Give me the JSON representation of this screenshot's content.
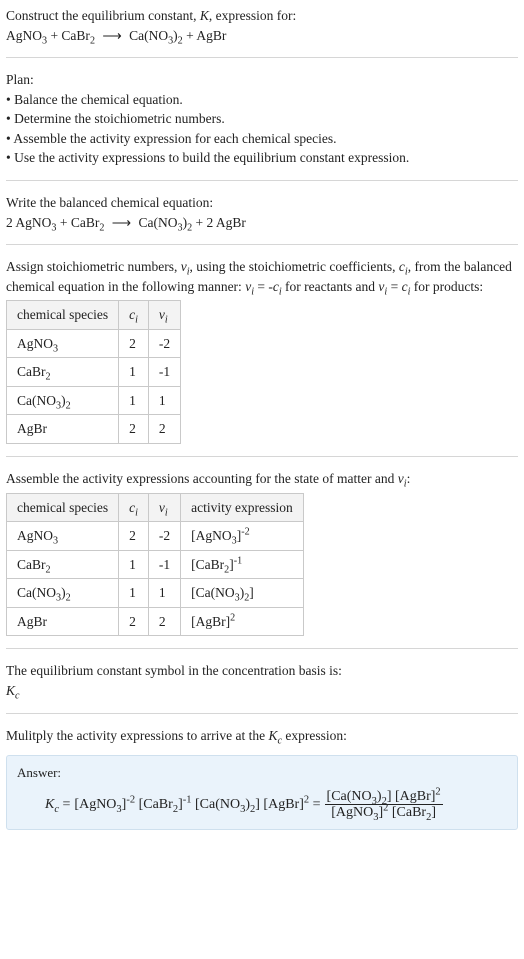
{
  "header": {
    "prompt_line1": "Construct the equilibrium constant, K, expression for:",
    "reaction_unbalanced": "AgNO₃ + CaBr₂  ⟶  Ca(NO₃)₂ + AgBr"
  },
  "plan": {
    "title": "Plan:",
    "items": [
      "Balance the chemical equation.",
      "Determine the stoichiometric numbers.",
      "Assemble the activity expression for each chemical species.",
      "Use the activity expressions to build the equilibrium constant expression."
    ]
  },
  "balanced": {
    "intro": "Write the balanced chemical equation:",
    "equation": "2 AgNO₃ + CaBr₂  ⟶  Ca(NO₃)₂ + 2 AgBr"
  },
  "stoich": {
    "intro_a": "Assign stoichiometric numbers, νᵢ, using the stoichiometric coefficients, cᵢ, from the balanced chemical equation in the following manner: νᵢ = -cᵢ for reactants and νᵢ = cᵢ for products:",
    "headers": {
      "species": "chemical species",
      "c": "cᵢ",
      "v": "νᵢ"
    },
    "rows": [
      {
        "species": "AgNO₃",
        "c": "2",
        "v": "-2"
      },
      {
        "species": "CaBr₂",
        "c": "1",
        "v": "-1"
      },
      {
        "species": "Ca(NO₃)₂",
        "c": "1",
        "v": "1"
      },
      {
        "species": "AgBr",
        "c": "2",
        "v": "2"
      }
    ]
  },
  "activity": {
    "intro": "Assemble the activity expressions accounting for the state of matter and νᵢ:",
    "headers": {
      "species": "chemical species",
      "c": "cᵢ",
      "v": "νᵢ",
      "expr": "activity expression"
    },
    "rows": [
      {
        "species": "AgNO₃",
        "c": "2",
        "v": "-2",
        "expr": "[AgNO₃]⁻²"
      },
      {
        "species": "CaBr₂",
        "c": "1",
        "v": "-1",
        "expr": "[CaBr₂]⁻¹"
      },
      {
        "species": "Ca(NO₃)₂",
        "c": "1",
        "v": "1",
        "expr": "[Ca(NO₃)₂]"
      },
      {
        "species": "AgBr",
        "c": "2",
        "v": "2",
        "expr": "[AgBr]²"
      }
    ]
  },
  "symbol": {
    "line1": "The equilibrium constant symbol in the concentration basis is:",
    "line2": "K_c"
  },
  "multiply": {
    "intro": "Mulitply the activity expressions to arrive at the K_c expression:"
  },
  "answer": {
    "label": "Answer:",
    "lhs": "K_c = ",
    "prod": "[AgNO₃]⁻² [CaBr₂]⁻¹ [Ca(NO₃)₂] [AgBr]² = ",
    "frac_num": "[Ca(NO₃)₂] [AgBr]²",
    "frac_den": "[AgNO₃]² [CaBr₂]"
  },
  "chart_data": {
    "type": "table",
    "tables": [
      {
        "name": "stoichiometric_numbers",
        "columns": [
          "chemical species",
          "c_i",
          "ν_i"
        ],
        "rows": [
          [
            "AgNO3",
            2,
            -2
          ],
          [
            "CaBr2",
            1,
            -1
          ],
          [
            "Ca(NO3)2",
            1,
            1
          ],
          [
            "AgBr",
            2,
            2
          ]
        ]
      },
      {
        "name": "activity_expressions",
        "columns": [
          "chemical species",
          "c_i",
          "ν_i",
          "activity expression"
        ],
        "rows": [
          [
            "AgNO3",
            2,
            -2,
            "[AgNO3]^-2"
          ],
          [
            "CaBr2",
            1,
            -1,
            "[CaBr2]^-1"
          ],
          [
            "Ca(NO3)2",
            1,
            1,
            "[Ca(NO3)2]"
          ],
          [
            "AgBr",
            2,
            2,
            "[AgBr]^2"
          ]
        ]
      }
    ],
    "equilibrium_constant": "K_c = [Ca(NO3)2][AgBr]^2 / ([AgNO3]^2 [CaBr2])"
  }
}
